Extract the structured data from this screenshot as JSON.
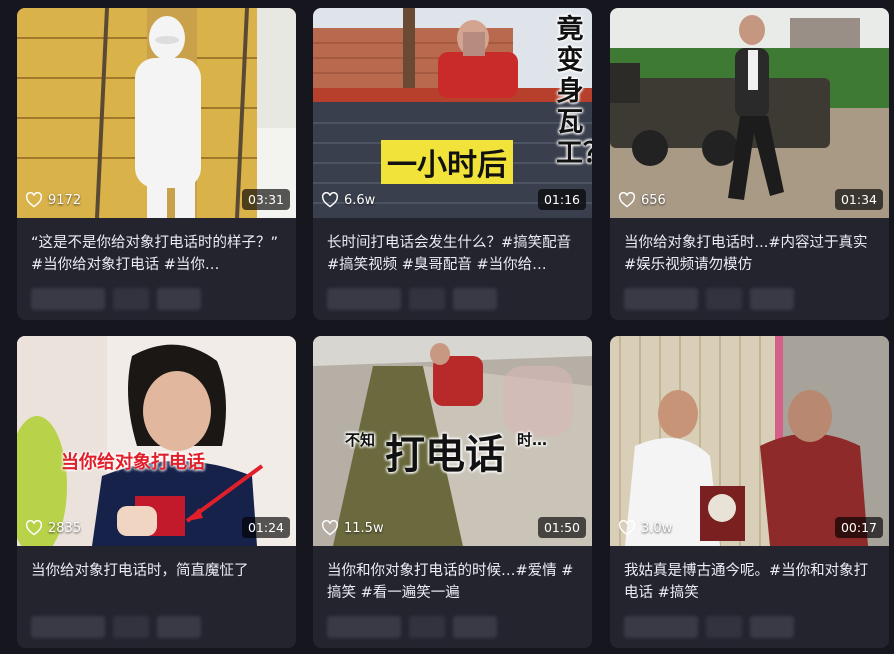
{
  "cards": [
    {
      "likes": "9172",
      "duration": "03:31",
      "title": "“这是不是你给对象打电话时的样子？” #当你给对象打电话 #当你…",
      "overlay": []
    },
    {
      "likes": "6.6w",
      "duration": "01:16",
      "title": "长时间打电话会发生什么？#搞笑配音 #搞笑视频 #臭哥配音 #当你给…",
      "overlay": [
        "竟变身瓦工？",
        "一小时后"
      ]
    },
    {
      "likes": "656",
      "duration": "01:34",
      "title": "当你给对象打电话时...#内容过于真实 #娱乐视频请勿模仿",
      "overlay": []
    },
    {
      "likes": "2835",
      "duration": "01:24",
      "title": "当你给对象打电话时，简直魔怔了",
      "overlay": [
        "当你给对象打电话"
      ]
    },
    {
      "likes": "11.5w",
      "duration": "01:50",
      "title": "当你和你对象打电话的时候…#爱情 #搞笑 #看一遍笑一遍",
      "overlay": [
        "不知",
        "打电话",
        "时…"
      ]
    },
    {
      "likes": "3.0w",
      "duration": "00:17",
      "title": "我姑真是博古通今呢。#当你和对象打电话 #搞笑",
      "overlay": []
    }
  ],
  "icons": {
    "like": "heart-outline-icon"
  },
  "colors": {
    "background": "#16161f",
    "card": "#24242f",
    "accent_red": "#e01f2a"
  }
}
